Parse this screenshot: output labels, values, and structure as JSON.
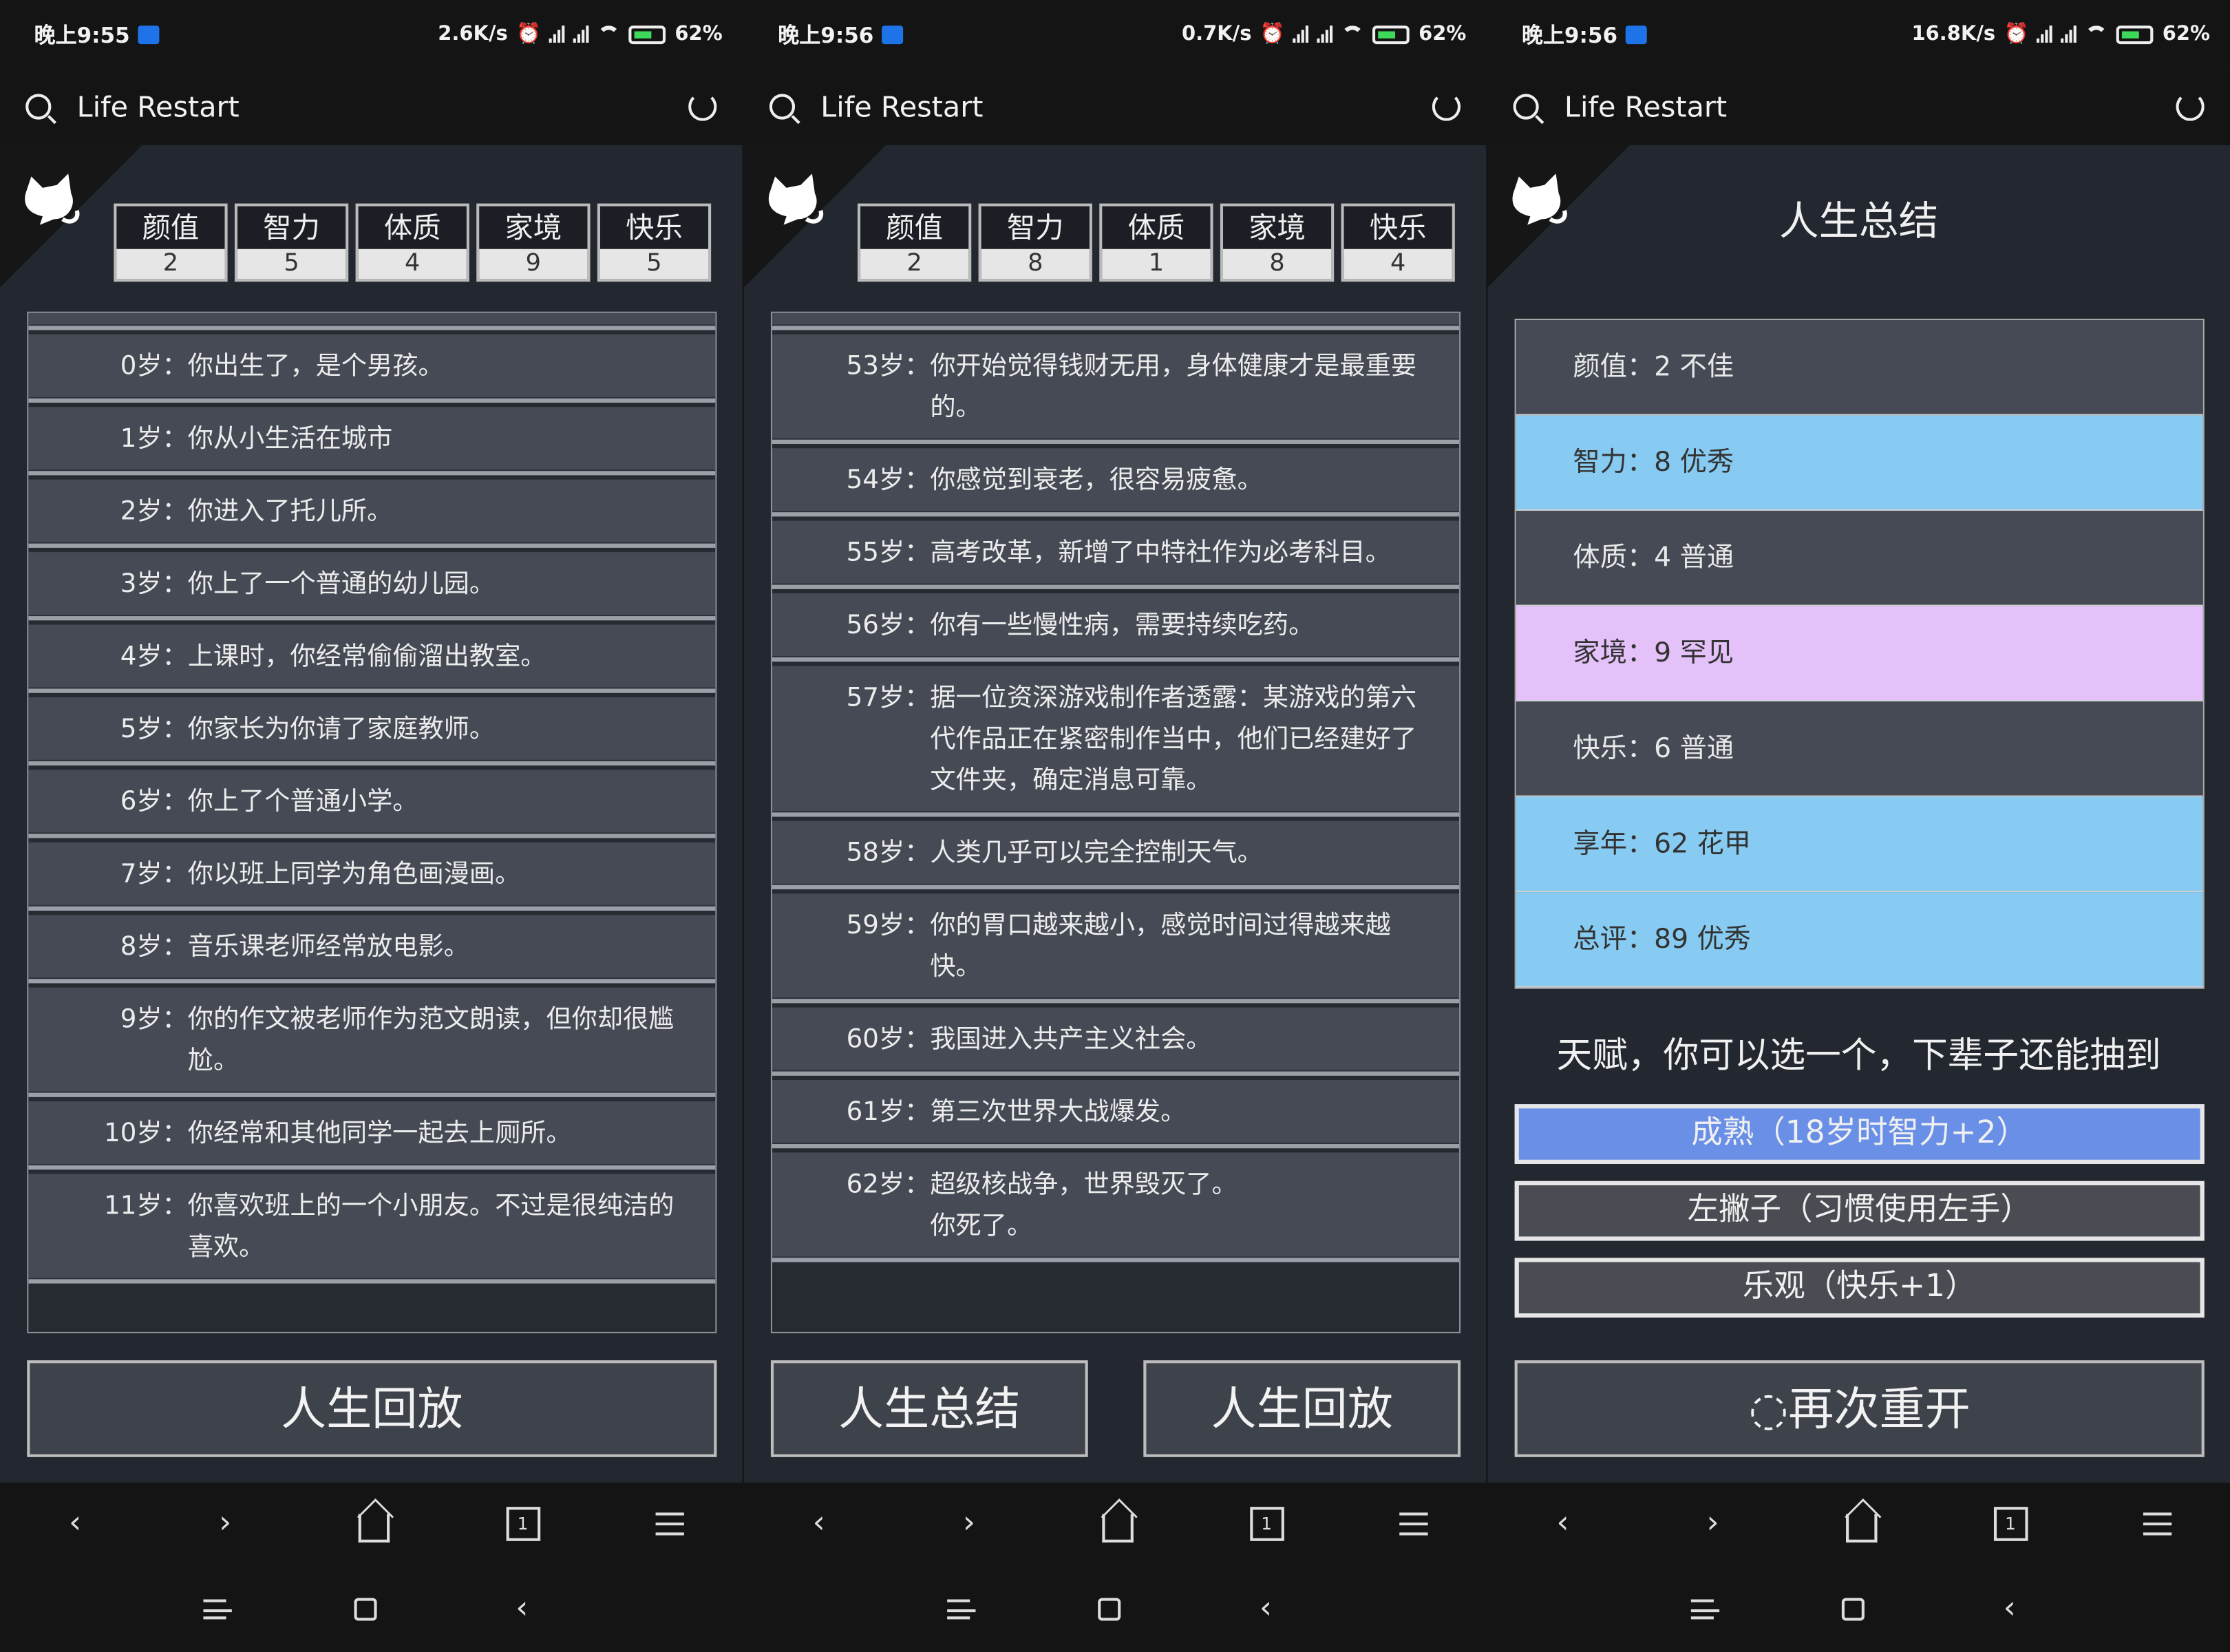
{
  "browser": {
    "title": "Life Restart"
  },
  "screens": [
    {
      "status": {
        "time": "晚上9:55",
        "speed": "2.6K/s",
        "battery": "62"
      },
      "props": [
        {
          "label": "颜值",
          "value": "2"
        },
        {
          "label": "智力",
          "value": "5"
        },
        {
          "label": "体质",
          "value": "4"
        },
        {
          "label": "家境",
          "value": "9"
        },
        {
          "label": "快乐",
          "value": "5"
        }
      ],
      "trajectory": [
        {
          "age": "0岁：",
          "text": "你出生了，是个男孩。"
        },
        {
          "age": "1岁：",
          "text": "你从小生活在城市"
        },
        {
          "age": "2岁：",
          "text": "你进入了托儿所。"
        },
        {
          "age": "3岁：",
          "text": "你上了一个普通的幼儿园。"
        },
        {
          "age": "4岁：",
          "text": "上课时，你经常偷偷溜出教室。"
        },
        {
          "age": "5岁：",
          "text": "你家长为你请了家庭教师。"
        },
        {
          "age": "6岁：",
          "text": "你上了个普通小学。"
        },
        {
          "age": "7岁：",
          "text": "你以班上同学为角色画漫画。"
        },
        {
          "age": "8岁：",
          "text": "音乐课老师经常放电影。"
        },
        {
          "age": "9岁：",
          "text": "你的作文被老师作为范文朗读，但你却很尴尬。"
        },
        {
          "age": "10岁：",
          "text": "你经常和其他同学一起去上厕所。"
        },
        {
          "age": "11岁：",
          "text": "你喜欢班上的一个小朋友。不过是很纯洁的喜欢。"
        }
      ],
      "buttons": {
        "replay": "人生回放"
      }
    },
    {
      "status": {
        "time": "晚上9:56",
        "speed": "0.7K/s",
        "battery": "62"
      },
      "props": [
        {
          "label": "颜值",
          "value": "2"
        },
        {
          "label": "智力",
          "value": "8"
        },
        {
          "label": "体质",
          "value": "1"
        },
        {
          "label": "家境",
          "value": "8"
        },
        {
          "label": "快乐",
          "value": "4"
        }
      ],
      "trajectory": [
        {
          "age": "53岁：",
          "text": "你开始觉得钱财无用，身体健康才是最重要的。"
        },
        {
          "age": "54岁：",
          "text": "你感觉到衰老，很容易疲惫。"
        },
        {
          "age": "55岁：",
          "text": "高考改革，新增了中特社作为必考科目。"
        },
        {
          "age": "56岁：",
          "text": "你有一些慢性病，需要持续吃药。"
        },
        {
          "age": "57岁：",
          "text": "据一位资深游戏制作者透露：某游戏的第六代作品正在紧密制作当中，他们已经建好了文件夹，确定消息可靠。"
        },
        {
          "age": "58岁：",
          "text": "人类几乎可以完全控制天气。"
        },
        {
          "age": "59岁：",
          "text": "你的胃口越来越小，感觉时间过得越来越快。"
        },
        {
          "age": "60岁：",
          "text": "我国进入共产主义社会。"
        },
        {
          "age": "61岁：",
          "text": "第三次世界大战爆发。"
        },
        {
          "age": "62岁：",
          "text": "超级核战争，世界毁灭了。",
          "text2": "你死了。"
        }
      ],
      "buttons": {
        "summary": "人生总结",
        "replay": "人生回放"
      }
    },
    {
      "status": {
        "time": "晚上9:56",
        "speed": "16.8K/s",
        "battery": "62"
      },
      "title": "人生总结",
      "summary": [
        {
          "text": "颜值：2 不佳",
          "style": "dark"
        },
        {
          "text": "智力：8 优秀",
          "style": "blue"
        },
        {
          "text": "体质：4 普通",
          "style": "dark"
        },
        {
          "text": "家境：9 罕见",
          "style": "purple"
        },
        {
          "text": "快乐：6 普通",
          "style": "dark"
        },
        {
          "text": "享年：62 花甲",
          "style": "blue"
        },
        {
          "text": "总评：89 优秀",
          "style": "blue"
        }
      ],
      "talent_prompt": "天赋，你可以选一个，下辈子还能抽到",
      "talents": [
        {
          "text": "成熟（18岁时智力+2）",
          "selected": true
        },
        {
          "text": "左撇子（习惯使用左手）",
          "selected": false
        },
        {
          "text": "乐观（快乐+1）",
          "selected": false
        }
      ],
      "buttons": {
        "restart": "再次重开"
      }
    }
  ],
  "colors": {
    "page_bg": "#23272f",
    "card": "#454a55",
    "blue": "#87cbf2",
    "purple": "#e4c1f9",
    "talent_selected": "#6a8fe6"
  }
}
